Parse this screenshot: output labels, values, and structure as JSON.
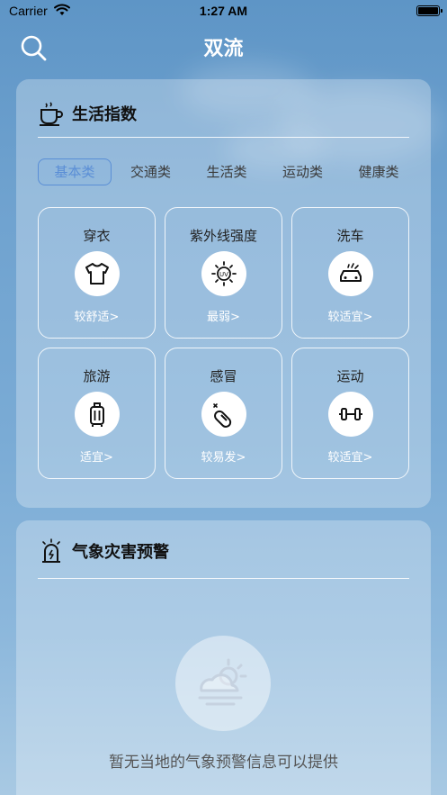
{
  "status_bar": {
    "carrier": "Carrier",
    "time": "1:27 AM"
  },
  "nav": {
    "title": "双流"
  },
  "life_index": {
    "title": "生活指数",
    "tabs": [
      {
        "label": "基本类",
        "active": true
      },
      {
        "label": "交通类",
        "active": false
      },
      {
        "label": "生活类",
        "active": false
      },
      {
        "label": "运动类",
        "active": false
      },
      {
        "label": "健康类",
        "active": false
      }
    ],
    "items": [
      {
        "name": "穿衣",
        "value": "较舒适>",
        "icon": "tshirt-icon"
      },
      {
        "name": "紫外线强度",
        "value": "最弱>",
        "icon": "uv-sun-icon"
      },
      {
        "name": "洗车",
        "value": "较适宜>",
        "icon": "car-wash-icon"
      },
      {
        "name": "旅游",
        "value": "适宜>",
        "icon": "luggage-icon"
      },
      {
        "name": "感冒",
        "value": "较易发>",
        "icon": "pill-icon"
      },
      {
        "name": "运动",
        "value": "较适宜>",
        "icon": "dumbbell-icon"
      }
    ]
  },
  "warning": {
    "title": "气象灾害预警",
    "empty_message": "暂无当地的气象预警信息可以提供"
  },
  "colors": {
    "accent": "#5a8ed6",
    "card": "rgba(255,255,255,0.28)"
  }
}
